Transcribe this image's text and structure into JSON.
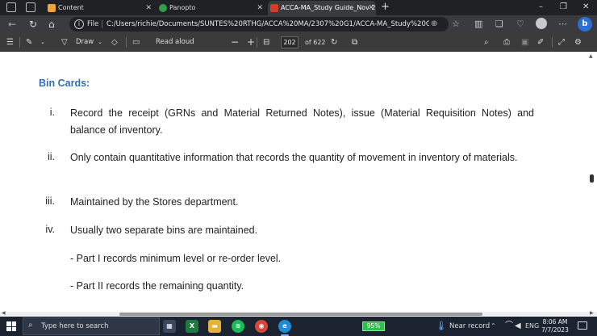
{
  "browser": {
    "tabs": [
      {
        "label": "Content",
        "favicon_color": "#f2a33a",
        "active": false
      },
      {
        "label": "Panopto",
        "favicon_color": "#2ea04a",
        "active": false
      },
      {
        "label": "ACCA-MA_Study Guide_Nov 20...",
        "favicon_color": "#d93b2b",
        "active": true
      }
    ],
    "new_tab_glyph": "+",
    "window_controls": {
      "minimize": "–",
      "restore": "❐",
      "close": "✕"
    },
    "address": {
      "scheme_label": "File",
      "url": "C:/Users/richie/Documents/SUNTES%20RTHG/ACCA%20MA/2307%20G1/ACCA-MA_Study%20Guide_Nov%2..."
    }
  },
  "pdf_toolbar": {
    "draw_label": "Draw",
    "read_aloud_label": "Read aloud",
    "zoom_out_glyph": "−",
    "zoom_in_glyph": "+",
    "current_page": "202",
    "page_total": "of 622"
  },
  "document": {
    "heading": "Bin Cards:",
    "items": [
      {
        "num": "i.",
        "text": "Record the receipt (GRNs and Material Returned Notes), issue (Material Requisition Notes) and balance of inventory."
      },
      {
        "num": "ii.",
        "text": "Only contain quantitative information that records the quantity of movement in inventory of materials."
      },
      {
        "num": "iii.",
        "text": "Maintained by the Stores department."
      },
      {
        "num": "iv.",
        "text": "Usually two separate bins are maintained."
      }
    ],
    "sub_items": [
      "- Part I records minimum level or re-order level.",
      "- Part II records the remaining quantity."
    ]
  },
  "taskbar": {
    "search_placeholder": "Type here to search",
    "battery_percent": "95%",
    "near_record_label": "Near record",
    "language": "ENG",
    "time": "8:06 AM",
    "date": "7/7/2023"
  }
}
